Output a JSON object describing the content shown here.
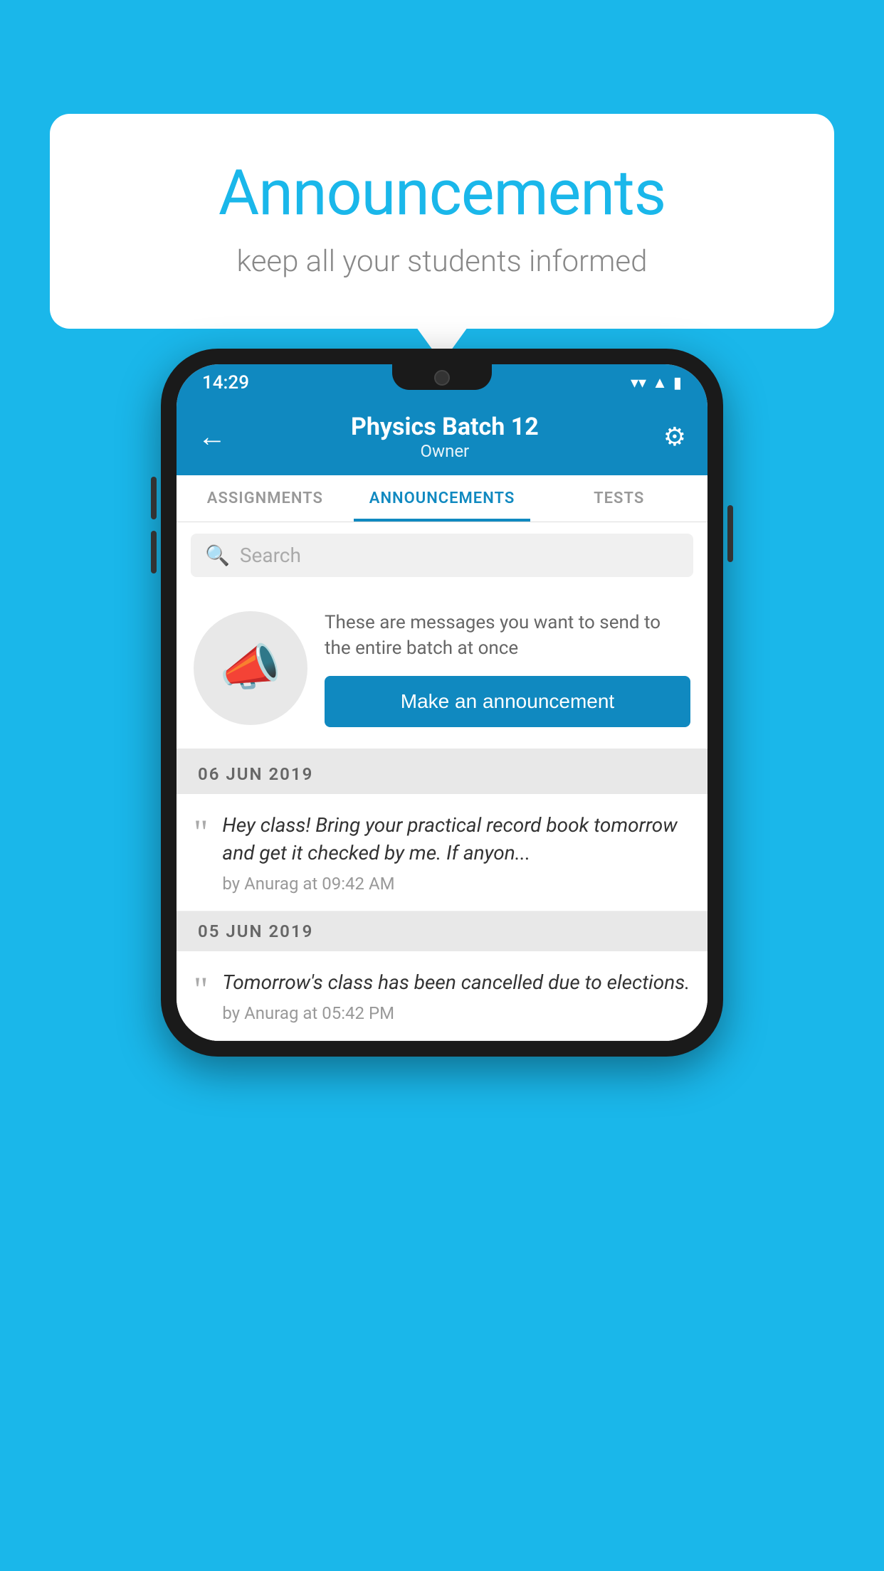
{
  "background_color": "#1ab7ea",
  "speech_bubble": {
    "title": "Announcements",
    "subtitle": "keep all your students informed"
  },
  "phone": {
    "status_bar": {
      "time": "14:29",
      "wifi": "▼",
      "signal": "▲",
      "battery": "▮"
    },
    "app_bar": {
      "back_icon": "←",
      "title": "Physics Batch 12",
      "subtitle": "Owner",
      "settings_icon": "⚙"
    },
    "tabs": [
      {
        "label": "ASSIGNMENTS",
        "active": false
      },
      {
        "label": "ANNOUNCEMENTS",
        "active": true
      },
      {
        "label": "TESTS",
        "active": false
      }
    ],
    "search": {
      "placeholder": "Search",
      "icon": "🔍"
    },
    "announcement_prompt": {
      "description": "These are messages you want to send to the entire batch at once",
      "button_label": "Make an announcement"
    },
    "announcements": [
      {
        "date": "06  JUN  2019",
        "text": "Hey class! Bring your practical record book tomorrow and get it checked by me. If anyon...",
        "meta": "by Anurag at 09:42 AM"
      },
      {
        "date": "05  JUN  2019",
        "text": "Tomorrow's class has been cancelled due to elections.",
        "meta": "by Anurag at 05:42 PM"
      }
    ]
  }
}
